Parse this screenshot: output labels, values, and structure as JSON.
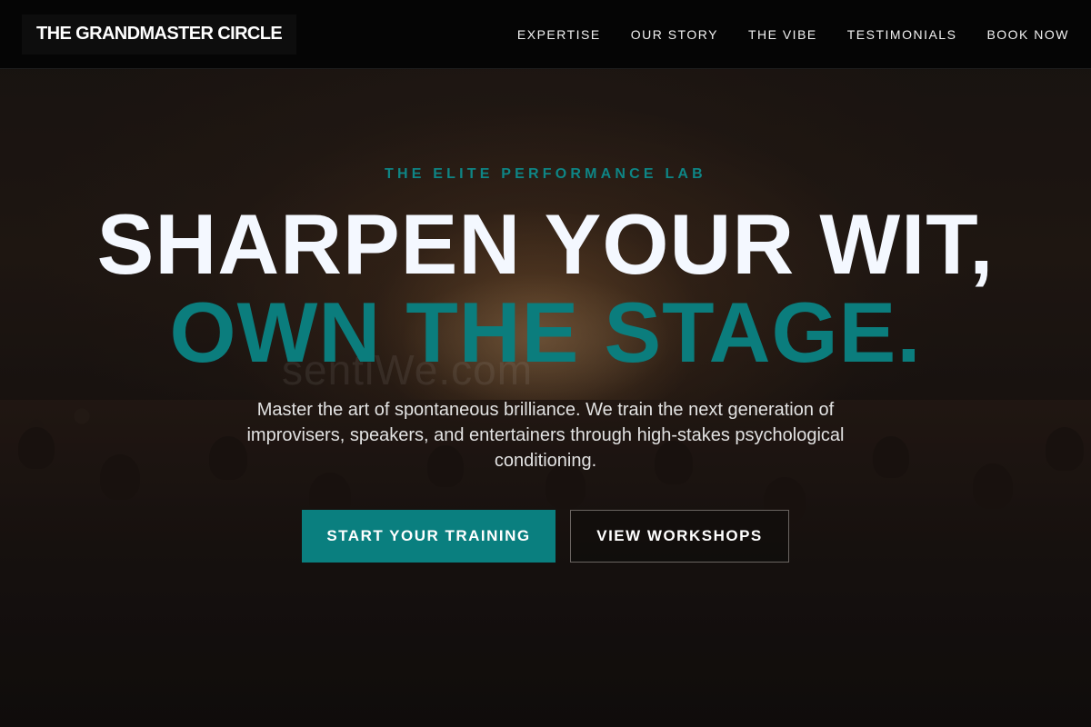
{
  "header": {
    "logo": "THE GRANDMASTER CIRCLE",
    "nav": [
      {
        "label": "EXPERTISE"
      },
      {
        "label": "OUR STORY"
      },
      {
        "label": "THE VIBE"
      },
      {
        "label": "TESTIMONIALS"
      },
      {
        "label": "BOOK NOW"
      }
    ]
  },
  "hero": {
    "eyebrow": "THE ELITE PERFORMANCE LAB",
    "headline_line1": "SHARPEN YOUR WIT,",
    "headline_line2": "OWN THE STAGE.",
    "description": "Master the art of spontaneous brilliance. We train the next generation of improvisers, speakers, and entertainers through high-stakes psychological conditioning.",
    "primary_button": "START YOUR TRAINING",
    "secondary_button": "VIEW WORKSHOPS",
    "background_watermark": "sentiWe.com"
  },
  "colors": {
    "accent": "#0a7f7f",
    "header_bg": "#050505",
    "headline_white": "#f4f8ff"
  }
}
